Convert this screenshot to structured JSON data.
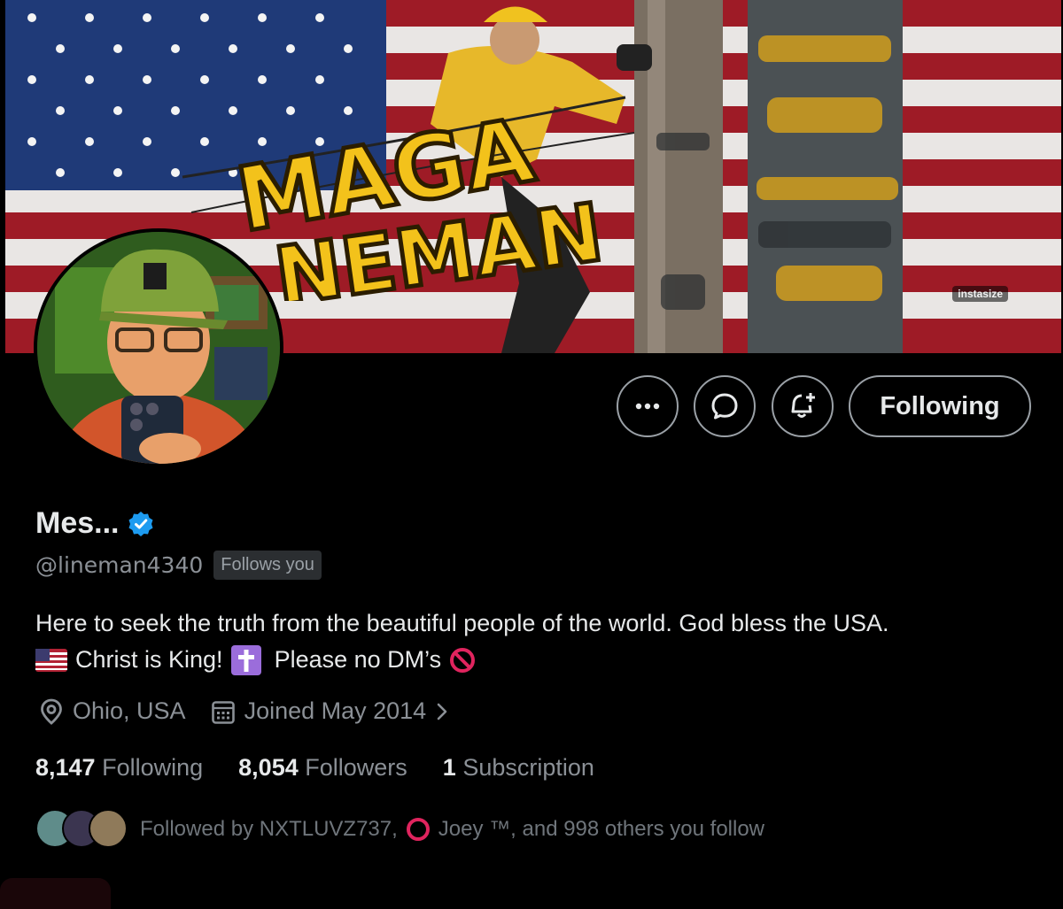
{
  "banner": {
    "tag": "instasize",
    "logo_line1": "MAGA",
    "logo_line2": "NEMAN"
  },
  "actions": {
    "more_icon": "more-icon",
    "message_icon": "message-icon",
    "notify_icon": "bell-plus-icon",
    "follow_label": "Following"
  },
  "profile": {
    "name": "Mes...",
    "verified": true,
    "handle": "@lineman4340",
    "follows_you": "Follows you",
    "bio_line1": "Here to seek the truth from the beautiful people of the world. God bless the USA.",
    "bio_christ": "Christ is King!",
    "bio_dm": "Please no DM’s",
    "location": "Ohio, USA",
    "joined": "Joined May 2014"
  },
  "stats": {
    "following_count": "8,147",
    "following_label": "Following",
    "followers_count": "8,054",
    "followers_label": "Followers",
    "subscription_count": "1",
    "subscription_label": "Subscription"
  },
  "followed_by": {
    "prefix": "Followed by NXTLUVZ737,",
    "joey": "Joey ™, and 998 others you follow"
  },
  "colors": {
    "background": "#000000",
    "verified": "#1d9bf0",
    "muted_text": "#8b9096",
    "cross_purple": "#9b6ddb",
    "no_sign_red": "#e0245e"
  }
}
